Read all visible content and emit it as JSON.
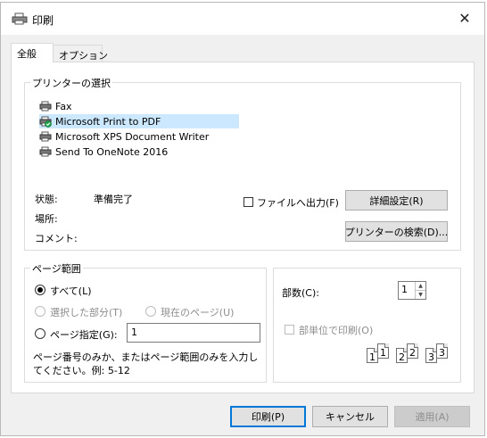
{
  "window": {
    "title": "印刷"
  },
  "tabs": [
    {
      "label": "全般"
    },
    {
      "label": "オプション"
    }
  ],
  "printer_group": {
    "label": "プリンターの選択",
    "printers": [
      {
        "name": "Fax",
        "icon": "fax-icon"
      },
      {
        "name": "Microsoft Print to PDF",
        "icon": "default-printer-icon",
        "selected": true
      },
      {
        "name": "Microsoft XPS Document Writer",
        "icon": "printer-icon"
      },
      {
        "name": "Send To OneNote 2016",
        "icon": "printer-icon"
      }
    ],
    "status_label": "状態:",
    "status_value": "準備完了",
    "location_label": "場所:",
    "comment_label": "コメント:",
    "print_to_file_label": "ファイルへ出力(F)",
    "preferences_button": "詳細設定(R)",
    "find_printer_button": "プリンターの検索(D)..."
  },
  "page_range": {
    "label": "ページ範囲",
    "all_label": "すべて(L)",
    "selection_label": "選択した部分(T)",
    "current_page_label": "現在のページ(U)",
    "pages_label": "ページ指定(G):",
    "pages_value": "1",
    "hint": "ページ番号のみか、またはページ範囲のみを入力してください。例: 5-12"
  },
  "copies": {
    "label": "部数(C):",
    "value": "1",
    "collate_label": "部単位で印刷(O)",
    "collate_pages": [
      "1",
      "1",
      "2",
      "2",
      "3",
      "3"
    ]
  },
  "footer": {
    "print_button": "印刷(P)",
    "cancel_button": "キャンセル",
    "apply_button": "適用(A)"
  },
  "colors": {
    "selection": "#cce8ff",
    "default_button_border": "#0078d7",
    "default_printer_check": "#1aa34a"
  }
}
